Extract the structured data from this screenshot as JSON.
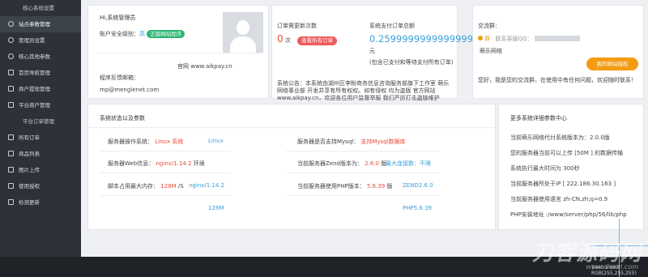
{
  "sidebar": {
    "items": [
      {
        "label": "核心系统设置",
        "type": "group"
      },
      {
        "label": "站点参数管理",
        "type": "item"
      },
      {
        "label": "管理员设置",
        "type": "item"
      },
      {
        "label": "核心其他参数",
        "type": "item"
      },
      {
        "label": "首页导航管理",
        "type": "item"
      },
      {
        "label": "商户提现管理",
        "type": "item"
      },
      {
        "label": "平台商户管理",
        "type": "item"
      },
      {
        "label": "平台订单管理",
        "type": "group"
      },
      {
        "label": "所有订单",
        "type": "item"
      },
      {
        "label": "商品列表",
        "type": "item"
      },
      {
        "label": "图片上传",
        "type": "item"
      },
      {
        "label": "使用授权",
        "type": "item"
      },
      {
        "label": "检测更新",
        "type": "item"
      }
    ]
  },
  "admin_card": {
    "greeting": "Hi,系统管理员",
    "security_label": "账户安全级别：",
    "security_level": "高",
    "licensed_badge": "正版网站程序",
    "website_label": "官网",
    "website": "www.aikpay.cn",
    "feedback_label": "程序反馈邮箱：",
    "feedback_email": "mp@menglenet.com"
  },
  "orders_card": {
    "pending_label": "订单需更新次数",
    "pending_count": "0",
    "pending_unit": "次",
    "view_all_button": "查看所有订单",
    "total_label": "系统支付订单总额",
    "total_value": "0.25999999999999995",
    "total_unit": "元",
    "total_note": "(包含已支付和等待支付所有订单)",
    "announcement": "系统公告：本系统由湖州区李盼商务信息咨询服务部旗下工作室 萌乐网络事业部 开发并享有所有权权。如有侵权 均为盗版 官方网站www.aikpay.cn，欢迎各位用户监督举报 我们严厉打击盗版维护"
  },
  "group_card": {
    "title": "交流群：",
    "online": "群",
    "contact_label": "联系客服QQ：",
    "contact_suffix": "萌乐网络",
    "license_button": "我的网站授权",
    "greeting": "您好，我是您的交流群，在使用中有任何问题，欢迎随时联系！"
  },
  "status_card": {
    "title": "系统状态以及参数",
    "rows_left": [
      {
        "label": "服务器操作系统：",
        "value": "Linux 系统",
        "extra": "Linux"
      },
      {
        "label": "服务器Web信息：",
        "value": "nginx/1.14.2",
        "value_suffix": "环境",
        "extra": ""
      },
      {
        "label": "脚本占用最大内存：",
        "value": "128M",
        "value_suffix": "/S",
        "extra": "nginx/1.14.2"
      },
      {
        "label": "",
        "value": "",
        "extra": "128M"
      }
    ],
    "rows_right": [
      {
        "label": "服务器是否支持Mysql：",
        "value": "支持Mysql数据库",
        "extra": ""
      },
      {
        "label": "当前服务器Zend版本为：",
        "value": "2.6.0",
        "value_suffix": "版",
        "extra": "最大连接数：不限"
      },
      {
        "label": "当前服务器使用PHP版本：",
        "value": "5.6.39",
        "value_suffix": "版",
        "extra": "ZEND2.6.0"
      },
      {
        "label": "",
        "value": "",
        "extra": "PHP5.6.39"
      }
    ]
  },
  "info_card": {
    "title": "更多系统详细参数中心",
    "lines": [
      "当前萌乐网络代付系统版本为：2.0.0版",
      "您的服务器当前可以上传 [50M ] 的数据传输",
      "系统执行最大时间为 300秒",
      "当前服务器所处于IP [ 222.186.30.163 ]",
      "当前服务器使用语言 zh-CN,zh;q=0.9",
      "PHP安装地址 :/www/server/php/56/lib/php"
    ]
  },
  "watermark": {
    "text": "刀客源码网",
    "url": "www.dkewl.com"
  },
  "inspector": {
    "size": "1440 x 647",
    "rgb": "RGB(255,255,255)"
  },
  "colors": {
    "sidebar_bg": "#2d3238",
    "success": "#2bb673",
    "danger": "#ef5b5b",
    "accent_orange": "#f39c12",
    "link_blue": "#3aa0d8"
  }
}
